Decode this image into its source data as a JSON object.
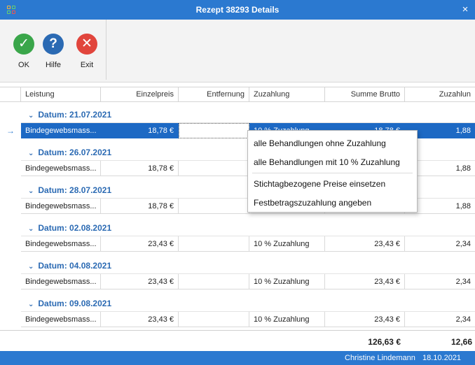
{
  "window": {
    "title": "Rezept 38293 Details",
    "close_glyph": "×"
  },
  "toolbar": {
    "buttons": [
      {
        "label": "OK",
        "icon": "check-icon",
        "glyph": "✓",
        "color": "#3aa64a"
      },
      {
        "label": "Hilfe",
        "icon": "help-icon",
        "glyph": "?",
        "color": "#2b6ab3"
      },
      {
        "label": "Exit",
        "icon": "close-circle-icon",
        "glyph": "✕",
        "color": "#e1453c"
      }
    ]
  },
  "grid": {
    "columns": [
      "Leistung",
      "Einzelpreis",
      "Entfernung",
      "Zuzahlung",
      "Summe Brutto",
      "Zuzahlun"
    ],
    "groups": [
      {
        "label": "Datum: 21.07.2021",
        "rows": [
          {
            "leistung": "Bindegewebsmass...",
            "einzelpreis": "18,78 €",
            "entfernung": "",
            "zuzahlung": "10 % Zuzahlung",
            "summe": "18,78 €",
            "zuz2": "1,88",
            "selected": true
          }
        ]
      },
      {
        "label": "Datum: 26.07.2021",
        "rows": [
          {
            "leistung": "Bindegewebsmass...",
            "einzelpreis": "18,78 €",
            "entfernung": "",
            "zuzahlung": "",
            "summe": "",
            "zuz2": "1,88"
          }
        ]
      },
      {
        "label": "Datum: 28.07.2021",
        "rows": [
          {
            "leistung": "Bindegewebsmass...",
            "einzelpreis": "18,78 €",
            "entfernung": "",
            "zuzahlung": "",
            "summe": "",
            "zuz2": "1,88"
          }
        ]
      },
      {
        "label": "Datum: 02.08.2021",
        "rows": [
          {
            "leistung": "Bindegewebsmass...",
            "einzelpreis": "23,43 €",
            "entfernung": "",
            "zuzahlung": "10 % Zuzahlung",
            "summe": "23,43 €",
            "zuz2": "2,34"
          }
        ]
      },
      {
        "label": "Datum: 04.08.2021",
        "rows": [
          {
            "leistung": "Bindegewebsmass...",
            "einzelpreis": "23,43 €",
            "entfernung": "",
            "zuzahlung": "10 % Zuzahlung",
            "summe": "23,43 €",
            "zuz2": "2,34"
          }
        ]
      },
      {
        "label": "Datum: 09.08.2021",
        "rows": [
          {
            "leistung": "Bindegewebsmass...",
            "einzelpreis": "23,43 €",
            "entfernung": "",
            "zuzahlung": "10 % Zuzahlung",
            "summe": "23,43 €",
            "zuz2": "2,34"
          }
        ]
      }
    ],
    "row_indicator": "→",
    "group_chevron": "⌄"
  },
  "footer": {
    "total_summe": "126,63 €",
    "total_zuzahlung": "12,66"
  },
  "context_menu": {
    "items": [
      "alle Behandlungen ohne Zuzahlung",
      "alle Behandlungen mit 10 % Zuzahlung",
      "Stichtagbezogene Preise einsetzen",
      "Festbetragszuzahlung angeben"
    ]
  },
  "status": {
    "user": "Christine Lindemann",
    "date": "18.10.2021"
  },
  "colors": {
    "accent": "#2b79d0",
    "selection": "#1d69c4",
    "group_text": "#2b6ab3"
  }
}
